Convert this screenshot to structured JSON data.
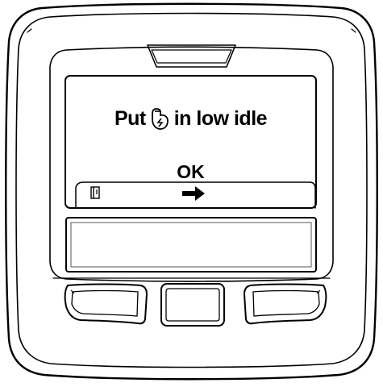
{
  "screen": {
    "prompt_before_icon": "Put",
    "prompt_after_icon": "in low idle",
    "prompt_icon": "throttle-icon",
    "ok_label": "OK"
  },
  "softkeys": {
    "left_icon": "exit-icon",
    "center_icon": "right-arrow-icon"
  },
  "colors": {
    "outline": "#000000",
    "background": "#ffffff"
  }
}
